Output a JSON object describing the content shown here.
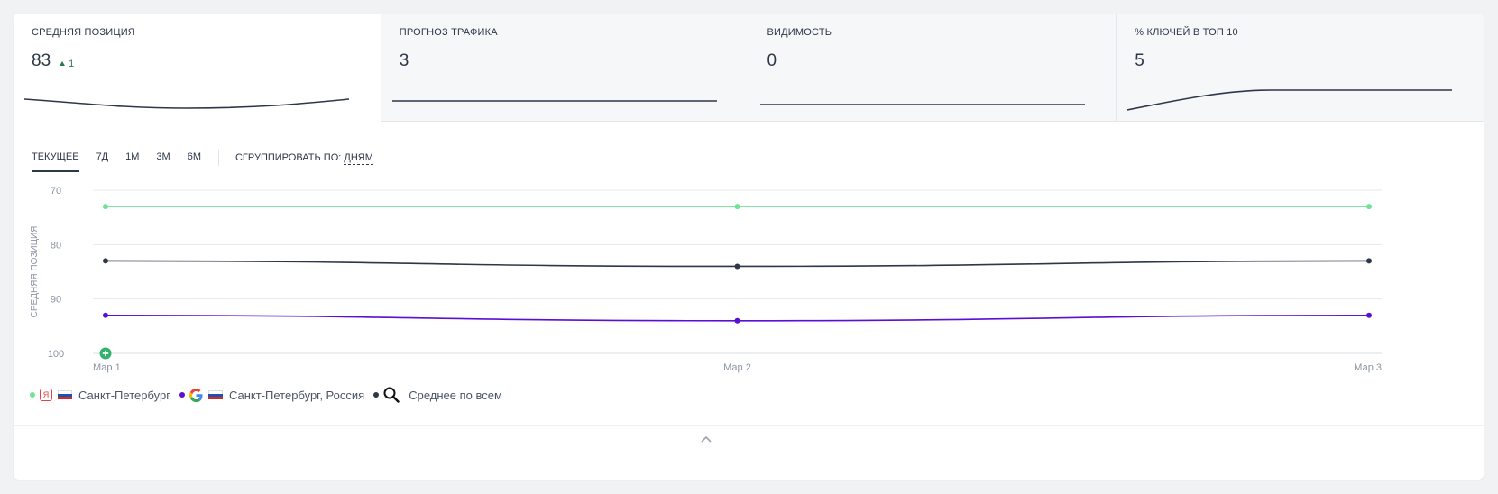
{
  "metrics": [
    {
      "title": "СРЕДНЯЯ ПОЗИЦИЯ",
      "value": "83",
      "delta": "1"
    },
    {
      "title": "ПРОГНОЗ ТРАФИКА",
      "value": "3"
    },
    {
      "title": "ВИДИМОСТЬ",
      "value": "0"
    },
    {
      "title": "% КЛЮЧЕЙ В ТОП 10",
      "value": "5"
    }
  ],
  "periods": [
    "ТЕКУЩЕЕ",
    "7Д",
    "1М",
    "3М",
    "6М"
  ],
  "active_period": "ТЕКУЩЕЕ",
  "group_by": {
    "label": "СГРУППИРОВАТЬ ПО:",
    "value": "ДНЯМ"
  },
  "legend": [
    {
      "engine_icon": "yandex-icon",
      "flag_icon": "russia-flag-icon",
      "label": "Санкт-Петербург",
      "color": "#6ee495"
    },
    {
      "engine_icon": "google-icon",
      "flag_icon": "russia-flag-icon",
      "label": "Санкт-Петербург, Россия",
      "color": "#5b0fd0"
    },
    {
      "engine_icon": "search-icon",
      "label": "Среднее по всем",
      "color": "#2d3748"
    }
  ],
  "chart_data": {
    "type": "line",
    "ylabel": "СРЕДНЯЯ ПОЗИЦИЯ",
    "y_inverted": true,
    "ylim": [
      70,
      100
    ],
    "yticks": [
      70,
      80,
      90,
      100
    ],
    "x": [
      "Мар 1",
      "Мар 2",
      "Мар 3"
    ],
    "grid": true,
    "series": [
      {
        "name": "Санкт-Петербург",
        "color": "#6ee495",
        "values": [
          73,
          73,
          73
        ]
      },
      {
        "name": "Среднее по всем",
        "color": "#2d3748",
        "values": [
          83,
          84,
          83
        ]
      },
      {
        "name": "Санкт-Петербург, Россия",
        "color": "#5b0fd0",
        "values": [
          93,
          94,
          93
        ]
      }
    ]
  }
}
